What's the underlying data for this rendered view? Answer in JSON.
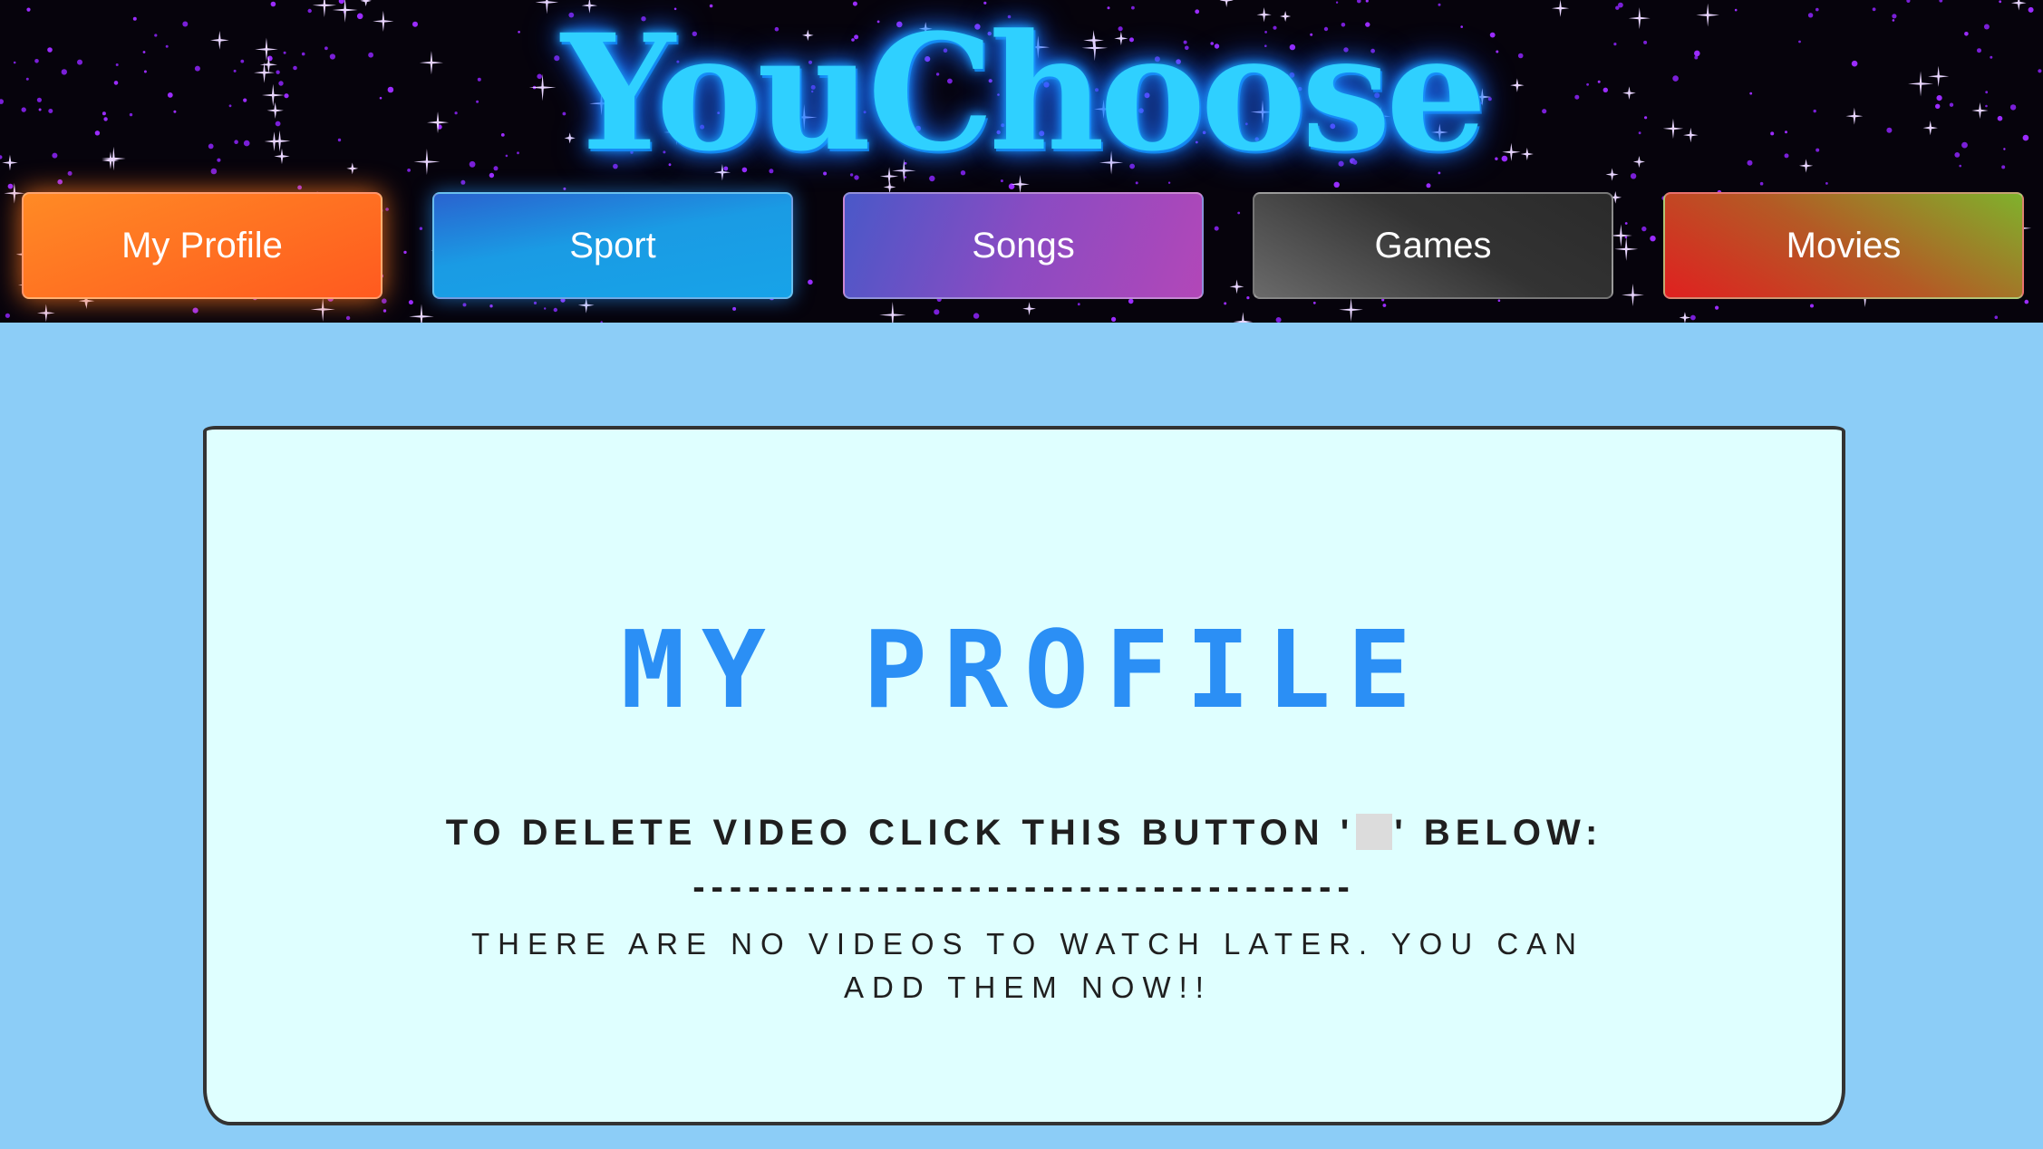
{
  "header": {
    "brand": "YouChoose",
    "nav": [
      {
        "label": "My Profile"
      },
      {
        "label": "Sport"
      },
      {
        "label": "Songs"
      },
      {
        "label": "Games"
      },
      {
        "label": "Movies"
      }
    ]
  },
  "main": {
    "title": "MY PROFILE",
    "instruction_before": "TO DELETE VIDEO CLICK THIS BUTTON '",
    "instruction_after": "' BELOW:",
    "divider": "------------------------------------",
    "empty_message": "THERE ARE NO VIDEOS TO WATCH LATER. YOU CAN ADD THEM NOW!!"
  },
  "colors": {
    "page_background": "#8ccdf7",
    "card_background": "#dfffff",
    "title_color": "#2b8ff5",
    "brand_color": "#2fd0ff"
  }
}
